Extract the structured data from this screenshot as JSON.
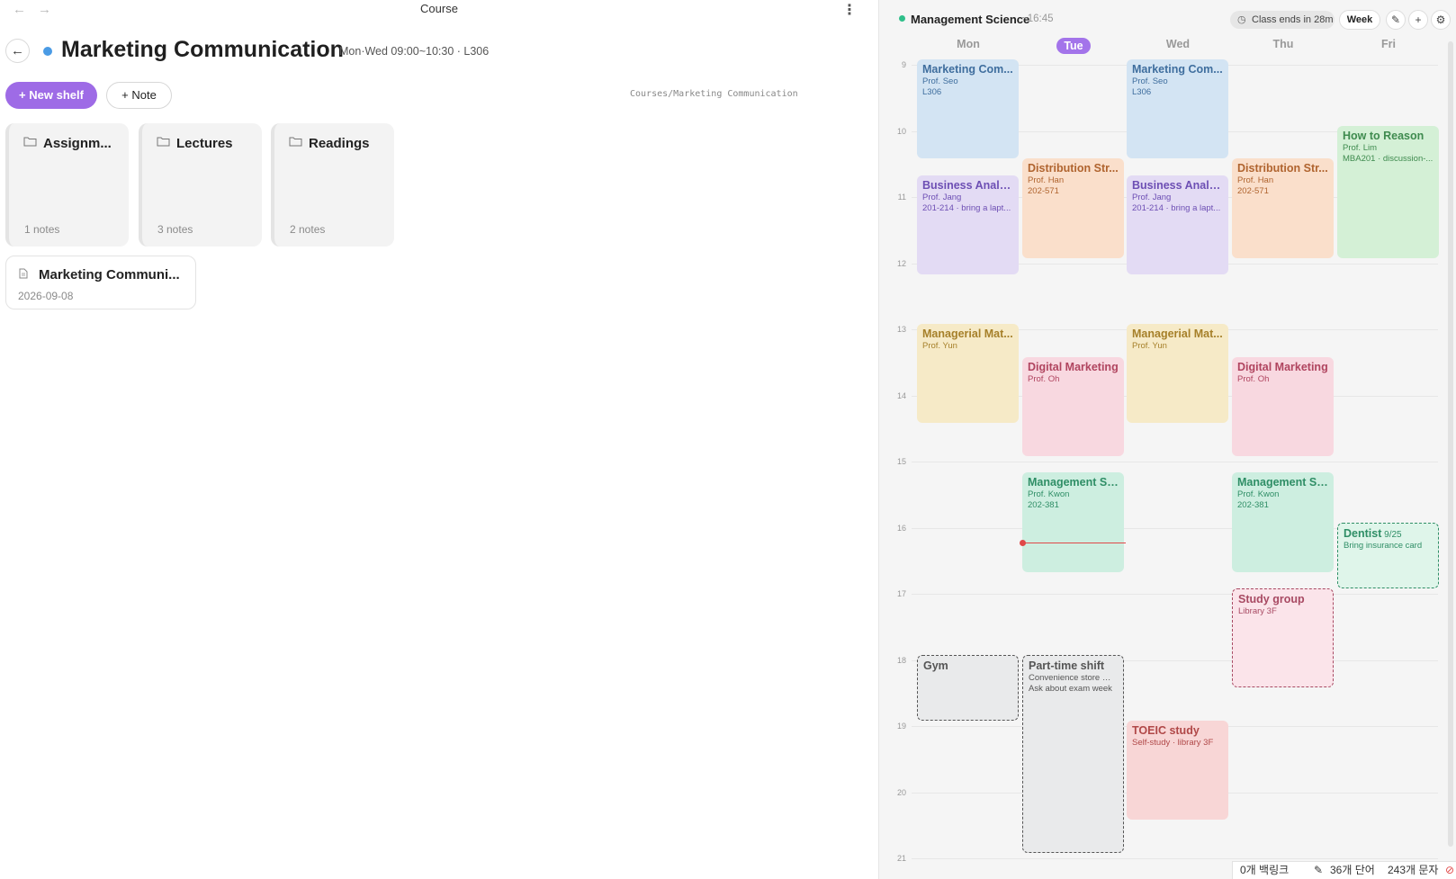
{
  "topbar": {
    "title": "Course",
    "back_arrow": "←",
    "forward_arrow": "→",
    "menu_icon": "⋮"
  },
  "course": {
    "back_icon": "←",
    "accent_color": "#4a9be5",
    "title": "Marketing Communication",
    "meta": "Mon·Wed 09:00~10:30 · L306"
  },
  "actions": {
    "new_shelf": "+ New shelf",
    "note": "+ Note"
  },
  "breadcrumb": "Courses/Marketing Communication",
  "shelves": [
    {
      "name": "Assignm...",
      "count": "1 notes",
      "icon": "folder-icon"
    },
    {
      "name": "Lectures",
      "count": "3 notes",
      "icon": "folder-icon"
    },
    {
      "name": "Readings",
      "count": "2 notes",
      "icon": "folder-icon"
    }
  ],
  "notes": [
    {
      "title": "Marketing Communi...",
      "date": "2026-09-08",
      "icon": "document-icon"
    }
  ],
  "calendar": {
    "current_course": "Management Science",
    "current_time": "~16:45",
    "status_pill": "Class ends in 28m",
    "view_button": "Week",
    "icons": [
      "pencil-icon",
      "plus-icon",
      "gear-icon"
    ],
    "days": [
      "Mon",
      "Tue",
      "Wed",
      "Thu",
      "Fri"
    ],
    "today": "Tue",
    "hours": [
      "9",
      "10",
      "11",
      "12",
      "13",
      "14",
      "15",
      "16",
      "17",
      "18",
      "19",
      "20",
      "21"
    ],
    "now_time": "16:18",
    "events": [
      {
        "day": "Mon",
        "title": "Marketing Com...",
        "lines": [
          "Prof. Seo",
          "L306"
        ],
        "start": 9.0,
        "end": 10.5,
        "color": "#d3e4f3",
        "text": "#3f6e9e"
      },
      {
        "day": "Wed",
        "title": "Marketing Com...",
        "lines": [
          "Prof. Seo",
          "L306"
        ],
        "start": 9.0,
        "end": 10.5,
        "color": "#d3e4f3",
        "text": "#3f6e9e"
      },
      {
        "day": "Fri",
        "title": "How to Reason",
        "lines": [
          "Prof. Lim",
          "MBA201 · discussion-..."
        ],
        "start": 10.0,
        "end": 12.0,
        "color": "#d4f0d6",
        "text": "#3f8b4f"
      },
      {
        "day": "Tue",
        "title": "Distribution Str...",
        "lines": [
          "Prof. Han",
          "202-571"
        ],
        "start": 10.5,
        "end": 12.0,
        "color": "#fadfcb",
        "text": "#b0642f"
      },
      {
        "day": "Thu",
        "title": "Distribution Str...",
        "lines": [
          "Prof. Han",
          "202-571"
        ],
        "start": 10.5,
        "end": 12.0,
        "color": "#fadfcb",
        "text": "#b0642f"
      },
      {
        "day": "Mon",
        "title": "Business Analyti...",
        "lines": [
          "Prof. Jang",
          "201-214 · bring a lapt..."
        ],
        "start": 10.75,
        "end": 12.25,
        "color": "#e3dbf4",
        "text": "#6d4fb4"
      },
      {
        "day": "Wed",
        "title": "Business Analyti...",
        "lines": [
          "Prof. Jang",
          "201-214 · bring a lapt..."
        ],
        "start": 10.75,
        "end": 12.25,
        "color": "#e3dbf4",
        "text": "#6d4fb4"
      },
      {
        "day": "Mon",
        "title": "Managerial Mat...",
        "lines": [
          "Prof. Yun"
        ],
        "start": 13.0,
        "end": 14.5,
        "color": "#f6eac7",
        "text": "#a6802a"
      },
      {
        "day": "Wed",
        "title": "Managerial Mat...",
        "lines": [
          "Prof. Yun"
        ],
        "start": 13.0,
        "end": 14.5,
        "color": "#f6eac7",
        "text": "#a6802a"
      },
      {
        "day": "Tue",
        "title": "Digital Marketing",
        "lines": [
          "Prof. Oh"
        ],
        "start": 13.5,
        "end": 15.0,
        "color": "#f8d8e0",
        "text": "#b0445f"
      },
      {
        "day": "Thu",
        "title": "Digital Marketing",
        "lines": [
          "Prof. Oh"
        ],
        "start": 13.5,
        "end": 15.0,
        "color": "#f8d8e0",
        "text": "#b0445f"
      },
      {
        "day": "Tue",
        "title": "Management Sc...",
        "lines": [
          "Prof. Kwon",
          "202-381"
        ],
        "start": 15.25,
        "end": 16.75,
        "color": "#cdeee0",
        "text": "#2f8e66"
      },
      {
        "day": "Thu",
        "title": "Management Sc...",
        "lines": [
          "Prof. Kwon",
          "202-381"
        ],
        "start": 15.25,
        "end": 16.75,
        "color": "#cdeee0",
        "text": "#2f8e66"
      },
      {
        "day": "Fri",
        "title": "Dentist",
        "date": "9/25",
        "lines": [
          "Bring insurance card"
        ],
        "start": 16.0,
        "end": 17.0,
        "color": "#dff5ea",
        "text": "#2f8e66",
        "dashed": true
      },
      {
        "day": "Thu",
        "title": "Study group",
        "lines": [
          "Library 3F"
        ],
        "start": 17.0,
        "end": 18.5,
        "color": "#fbe4ea",
        "text": "#a84a63",
        "dashed": true
      },
      {
        "day": "Mon",
        "title": "Gym",
        "lines": [],
        "start": 18.0,
        "end": 19.0,
        "color": "#e9eaeb",
        "text": "#555",
        "dashed": true
      },
      {
        "day": "Tue",
        "title": "Part-time shift",
        "lines": [
          "Convenience store —...",
          "Ask about exam week"
        ],
        "start": 18.0,
        "end": 21.0,
        "color": "#e9eaeb",
        "text": "#555",
        "dashed": true
      },
      {
        "day": "Wed",
        "title": "TOEIC study",
        "lines": [
          "Self-study · library 3F"
        ],
        "start": 19.0,
        "end": 20.5,
        "color": "#f8d6d6",
        "text": "#b04848"
      }
    ]
  },
  "statusbar": {
    "backlinks": "0개 백링크",
    "words": "36개 단어",
    "chars": "243개 문자",
    "edit_icon": "pencil-icon",
    "sync_icon": "sync-off-icon"
  }
}
